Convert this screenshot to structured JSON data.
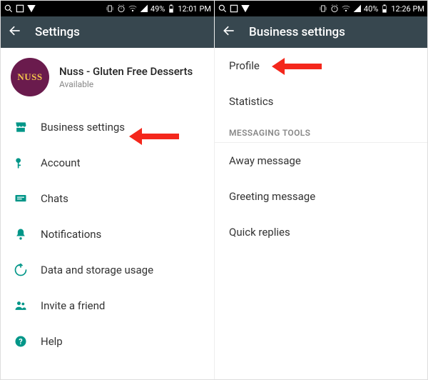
{
  "left": {
    "status": {
      "battery": "49%",
      "time": "12:01 PM"
    },
    "title": "Settings",
    "profile": {
      "name": "Nuss - Gluten Free Desserts",
      "subtitle": "Available",
      "avatar_label": "NUSS"
    },
    "items": [
      {
        "icon": "store-icon",
        "label": "Business settings"
      },
      {
        "icon": "key-icon",
        "label": "Account"
      },
      {
        "icon": "chat-icon",
        "label": "Chats"
      },
      {
        "icon": "bell-icon",
        "label": "Notifications"
      },
      {
        "icon": "data-icon",
        "label": "Data and storage usage"
      },
      {
        "icon": "people-icon",
        "label": "Invite a friend"
      },
      {
        "icon": "help-icon",
        "label": "Help"
      }
    ]
  },
  "right": {
    "status": {
      "battery": "40%",
      "time": "12:26 PM"
    },
    "title": "Business settings",
    "items_top": [
      {
        "label": "Profile"
      },
      {
        "label": "Statistics"
      }
    ],
    "section": "MESSAGING TOOLS",
    "items_bottom": [
      {
        "label": "Away message"
      },
      {
        "label": "Greeting message"
      },
      {
        "label": "Quick replies"
      }
    ]
  },
  "annotation_color": "#f4271c"
}
